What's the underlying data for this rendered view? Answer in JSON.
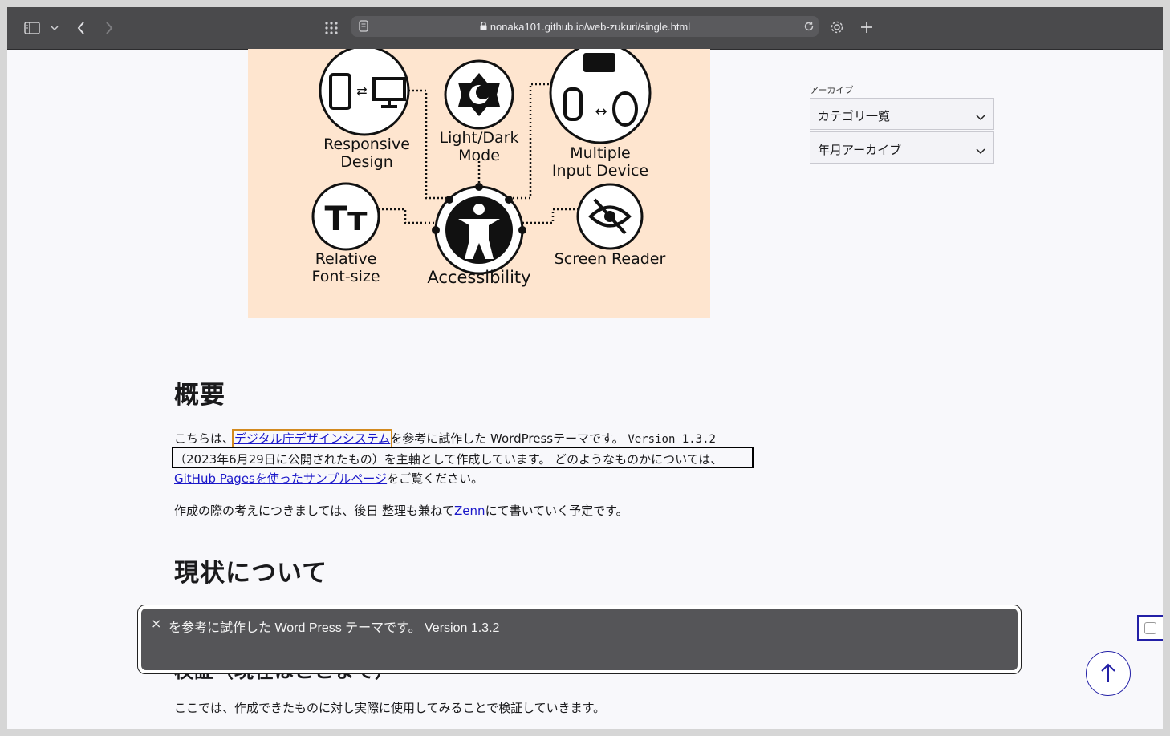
{
  "browser": {
    "url": "nonaka101.github.io/web-zukuri/single.html"
  },
  "hero": {
    "labels": {
      "responsive1": "Responsive",
      "responsive2": "Design",
      "lightdark1": "Light/Dark",
      "lightdark2": "Mode",
      "multiple1": "Multiple",
      "multiple2": "Input Device",
      "relative1": "Relative",
      "relative2": "Font-size",
      "accessibility": "Accessibility",
      "screenreader": "Screen Reader"
    }
  },
  "sidebar": {
    "title": "アーカイブ",
    "items": [
      {
        "label": "カテゴリ一覧"
      },
      {
        "label": "年月アーカイブ"
      }
    ]
  },
  "main": {
    "overview_heading": "概要",
    "p1": {
      "prefix": "こちらは、",
      "link1": "デジタル庁デザインシステム",
      "mid": "を参考に試作した WordPressテーマです。",
      "version": "Version 1.3.2",
      "line2": "（2023年6月29日に公開されたもの）を主軸として作成しています。 どのようなものかについては、",
      "link2": "GitHub Pagesを使ったサンプルページ",
      "suffix": "をご覧ください。"
    },
    "p2": {
      "prefix": "作成の際の考えにつきましては、後日 整理も兼ねて",
      "link": "Zenn",
      "suffix": "にて書いていく予定です。"
    },
    "status_heading": "現状について",
    "verify_heading_partial": "検証（現在はここまで）",
    "p3": "ここでは、作成できたものに対し実際に使用してみることで検証していきます。"
  },
  "popup": {
    "close": "×",
    "text": "を参考に試作した Word Press テーマです。 Version 1.3.2"
  }
}
